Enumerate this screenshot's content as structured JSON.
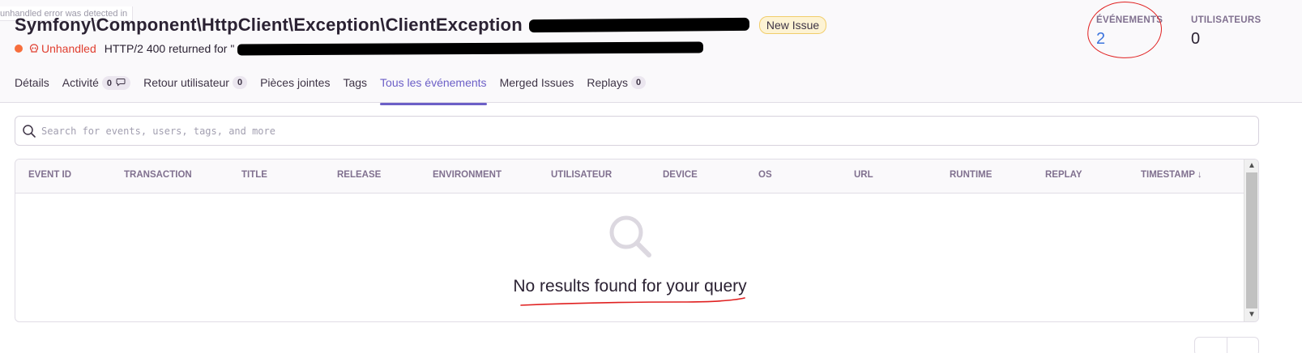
{
  "tooltip_fragment": "unhandled error was detected in",
  "issue": {
    "title": "Symfony\\Component\\HttpClient\\Exception\\ClientException",
    "badge": "New Issue",
    "level_label": "Unhandled",
    "message": "HTTP/2 400 returned for \""
  },
  "stats": {
    "events_label": "ÉVÉNEMENTS",
    "events_value": "2",
    "users_label": "UTILISATEURS",
    "users_value": "0"
  },
  "tabs": [
    {
      "label": "Détails"
    },
    {
      "label": "Activité",
      "count": "0"
    },
    {
      "label": "Retour utilisateur",
      "count": "0"
    },
    {
      "label": "Pièces jointes"
    },
    {
      "label": "Tags"
    },
    {
      "label": "Tous les événements",
      "active": true
    },
    {
      "label": "Merged Issues"
    },
    {
      "label": "Replays",
      "count": "0"
    }
  ],
  "search": {
    "placeholder": "Search for events, users, tags, and more",
    "value": ""
  },
  "table": {
    "columns": [
      "EVENT ID",
      "TRANSACTION",
      "TITLE",
      "RELEASE",
      "ENVIRONMENT",
      "UTILISATEUR",
      "DEVICE",
      "OS",
      "URL",
      "RUNTIME",
      "REPLAY",
      "TIMESTAMP ↓"
    ],
    "empty_message": "No results found for your query"
  },
  "colors": {
    "accent": "#6c5fc7",
    "error": "#e03e2f",
    "link": "#3c74dd",
    "annotation": "#e02020"
  }
}
